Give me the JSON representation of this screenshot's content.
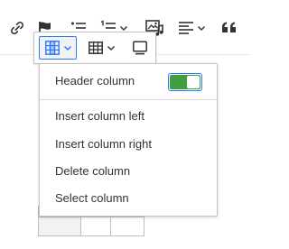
{
  "editor_toolbar": {
    "items": [
      {
        "icon": "link-icon"
      },
      {
        "icon": "flag-icon"
      },
      {
        "icon": "bulleted-list-icon",
        "has_dropdown": false
      },
      {
        "icon": "numbered-list-icon",
        "has_dropdown": true
      },
      {
        "icon": "image-audio-icon"
      },
      {
        "icon": "align-left-icon",
        "has_dropdown": true
      },
      {
        "icon": "quote-icon"
      }
    ]
  },
  "table_balloon": {
    "buttons": [
      {
        "icon": "table-column-icon",
        "active": true,
        "has_dropdown": true
      },
      {
        "icon": "table-merge-cells-icon",
        "active": false,
        "has_dropdown": true
      },
      {
        "icon": "table-caption-icon",
        "active": false,
        "has_dropdown": false
      }
    ]
  },
  "column_menu": {
    "header_column": {
      "label": "Header column",
      "toggle_on": true
    },
    "items": [
      {
        "label": "Insert column left"
      },
      {
        "label": "Insert column right"
      },
      {
        "label": "Delete column"
      },
      {
        "label": "Select column"
      }
    ]
  },
  "colors": {
    "accent": "#2977ff",
    "toggle_on": "#40a040",
    "active_button_bg": "#f2f2f2",
    "text": "#333333",
    "border": "#c4c4c4"
  }
}
